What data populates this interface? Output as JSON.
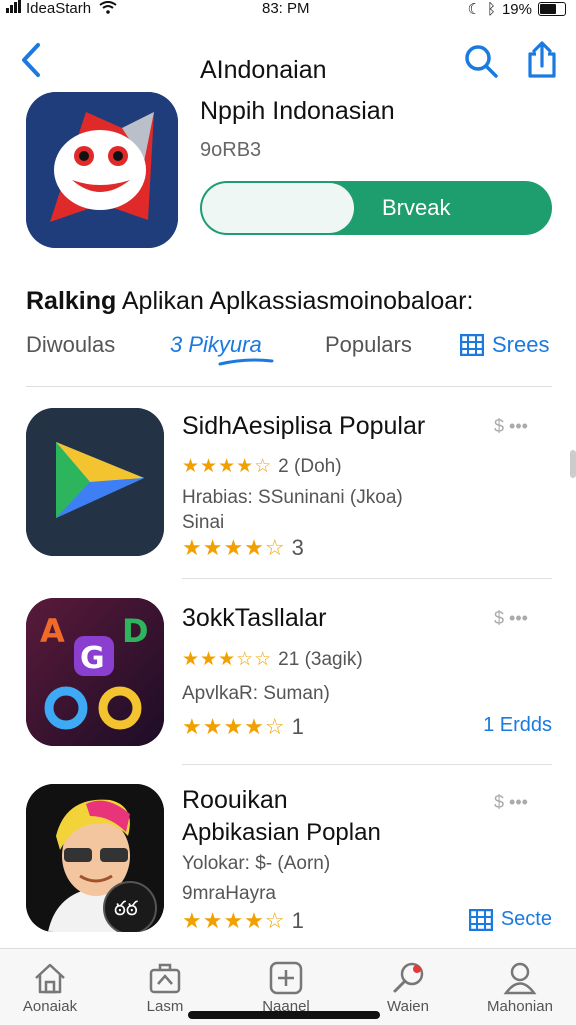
{
  "status_bar": {
    "carrier": "IdeaStarh",
    "time": "83: PM",
    "battery": "19%"
  },
  "app": {
    "title": "AIndonaian",
    "subtitle": "Nppih Indonasian",
    "meta": "9oRB3",
    "get_label": "Brveak"
  },
  "ranking": {
    "title_bold": "Ralking",
    "title_rest": " Aplikan Aplkassiasmoinobaloar:",
    "tabs": [
      "Diwoulas",
      "3 Pikyura",
      "Populars",
      "Srees"
    ],
    "active_tab": 1
  },
  "rows": [
    {
      "name": "SidhAesiplisa Popular",
      "rating_stars": "★★★★☆",
      "rating_text": "2 (Doh)",
      "line1": "Hrabias: SSuninani (Jkoa)",
      "line2": "Sinai",
      "stars2": "★★★★☆",
      "count2": "3",
      "price": "$",
      "link": ""
    },
    {
      "name": "3okkTasllalar",
      "rating_stars": "★★★☆☆",
      "rating_text": "21 (3agik)",
      "line1": "ApvlkaR: Suman)",
      "line2": "",
      "stars2": "★★★★☆",
      "count2": "1",
      "price": "$",
      "link": "1 Erdds"
    },
    {
      "name": "Roouikan",
      "name2": "Apbikasian Poplan",
      "line1": "Yolokar: $- (Aorn)",
      "line2": "9mraHayra",
      "stars2": "★★★★☆",
      "count2": "1",
      "price": "$",
      "link": "Secte"
    }
  ],
  "tab_bar": [
    {
      "label": "Aonaiak",
      "icon": "house-icon"
    },
    {
      "label": "Lasm",
      "icon": "briefcase-icon"
    },
    {
      "label": "Naanel",
      "icon": "plus-square-icon"
    },
    {
      "label": "Waien",
      "icon": "magnifier-icon"
    },
    {
      "label": "Mahonian",
      "icon": "person-icon"
    }
  ],
  "colors": {
    "accent": "#1a7ae0",
    "get_green": "#1e9e6e",
    "star": "#f2a000"
  }
}
